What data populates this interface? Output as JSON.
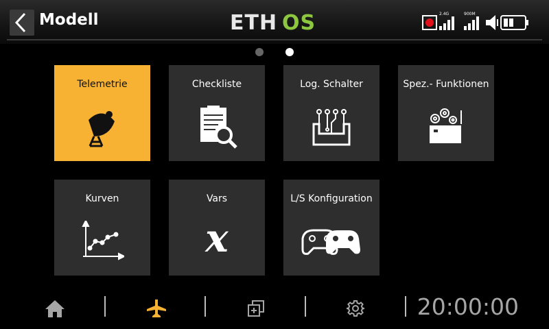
{
  "header": {
    "title": "Modell",
    "logo_text": "ETHOS",
    "rf_24_label": "2.4G",
    "rf_900_label": "900M",
    "colors": {
      "logo_green": "#8dc63f",
      "record_red": "#e0101a"
    }
  },
  "pager": {
    "pages": 2,
    "current": 2
  },
  "tiles": [
    {
      "label": "Telemetrie",
      "icon": "satellite-dish-icon",
      "active": true
    },
    {
      "label": "Checkliste",
      "icon": "checklist-icon"
    },
    {
      "label": "Log. Schalter",
      "icon": "logic-circuit-icon"
    },
    {
      "label": "Spez.- Funktionen",
      "icon": "gears-box-icon"
    },
    {
      "label": "Kurven",
      "icon": "curve-graph-icon"
    },
    {
      "label": "Vars",
      "icon": "variable-x-icon",
      "glyph": "x"
    },
    {
      "label": "L/S Konfiguration",
      "icon": "gamepads-icon"
    }
  ],
  "bottom": {
    "nav": [
      "home-icon",
      "airplane-icon",
      "add-model-icon",
      "settings-gear-icon"
    ],
    "active_nav": "airplane-icon",
    "accent": "#f7b234",
    "clock": "20:00:00"
  }
}
